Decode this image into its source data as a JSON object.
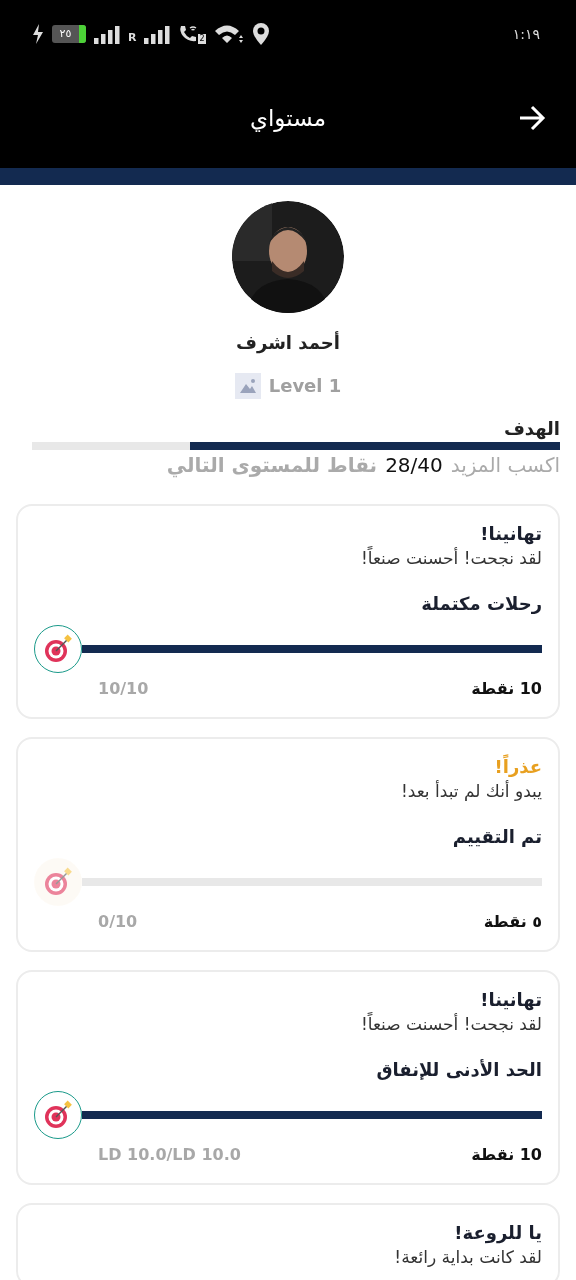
{
  "status_bar": {
    "battery": "٢٥",
    "roaming": "R",
    "sim": "2",
    "time": "١:١٩"
  },
  "header": {
    "title": "مستواي"
  },
  "profile": {
    "name": "أحمد اشرف",
    "level": "Level 1"
  },
  "goal": {
    "title": "الهدف",
    "level": 0.7,
    "prefix": "اكسب المزيد",
    "count": "28/40",
    "suffix": "نقاط للمستوى التالي"
  },
  "cards": [
    {
      "kind": "success",
      "title": "تهانينا!",
      "message": "لقد نجحت! أحسنت صنعاً!",
      "category": "رحلات مكتملة",
      "achieved": true,
      "level": 1,
      "points": "10 نقطة",
      "progress": "10/10"
    },
    {
      "kind": "warning",
      "title": "عذراً!",
      "message": "يبدو أنك لم تبدأ بعد!",
      "category": "تم التقييم",
      "achieved": false,
      "level": 0,
      "points": "٥ نقطة",
      "progress": "0/10"
    },
    {
      "kind": "success",
      "title": "تهانينا!",
      "message": "لقد نجحت! أحسنت صنعاً!",
      "category": "الحد الأدنى للإنفاق",
      "achieved": true,
      "level": 1,
      "points": "10 نقطة",
      "progress": "LD 10.0/LD 10.0"
    },
    {
      "kind": "success",
      "title": "يا للروعة!",
      "message": "لقد كانت بداية رائعة!"
    }
  ]
}
